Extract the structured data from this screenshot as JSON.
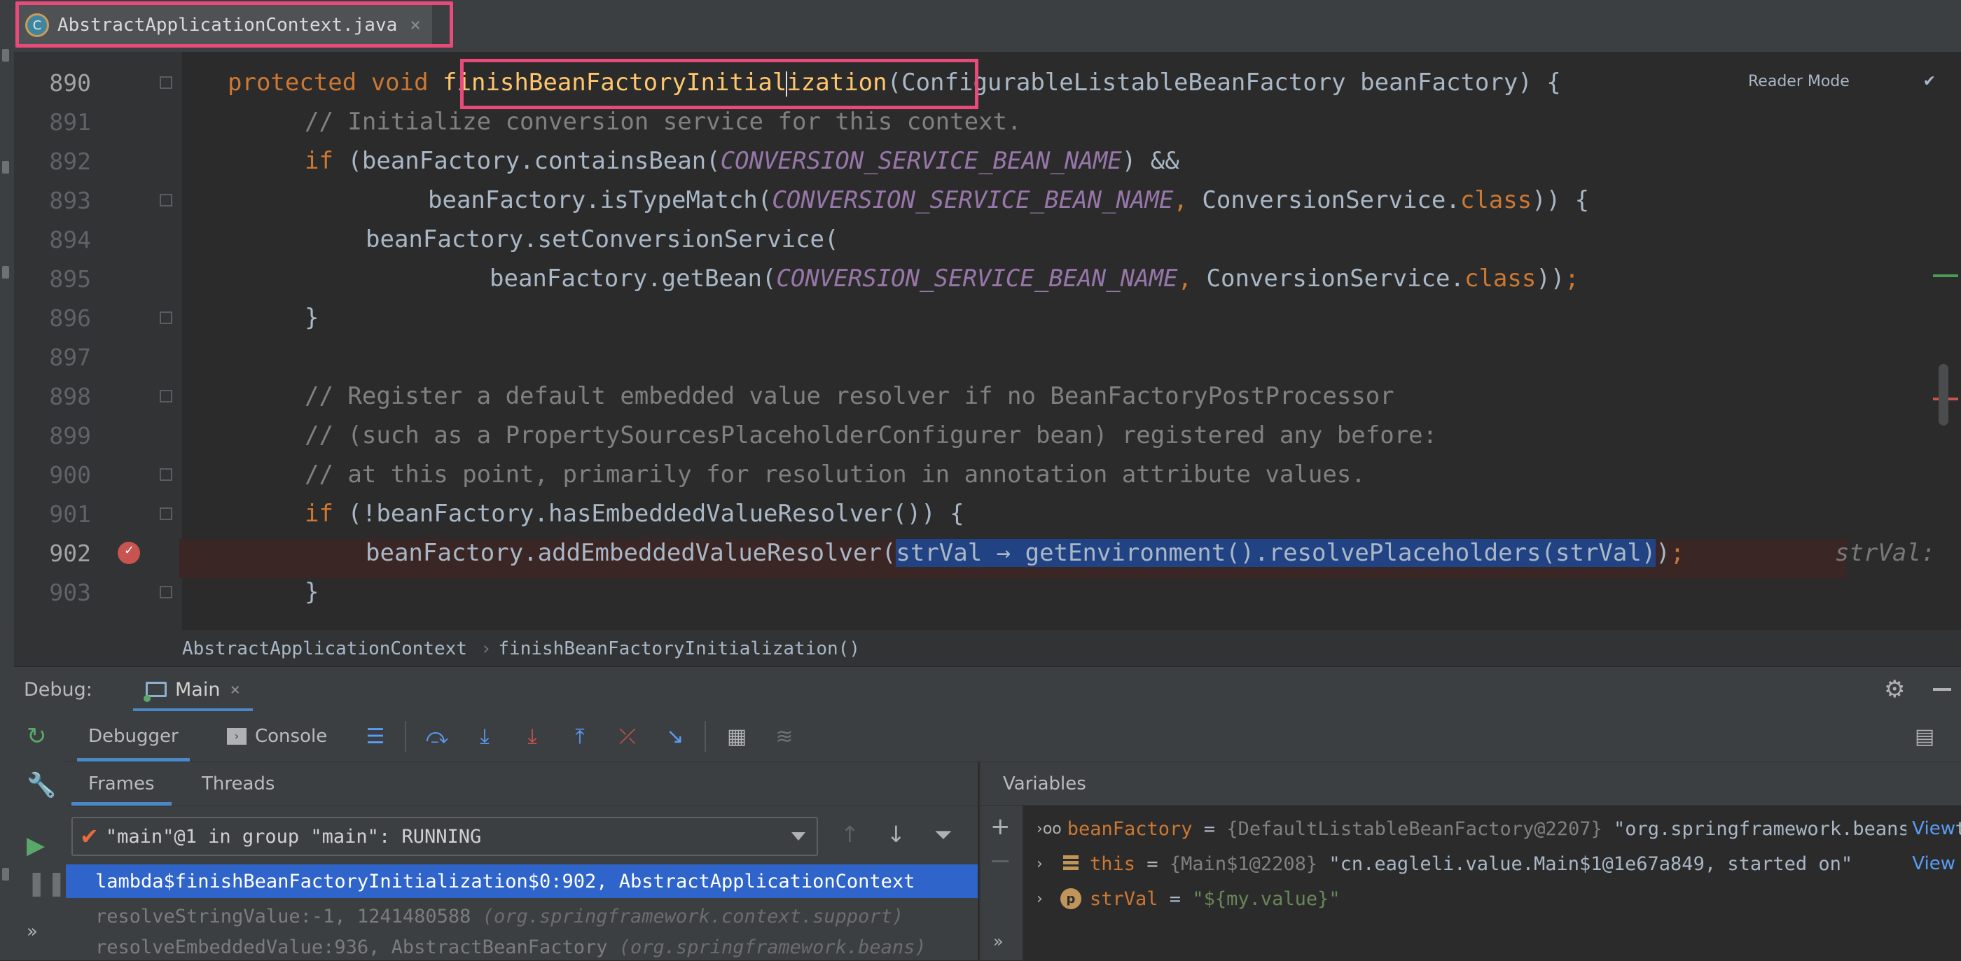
{
  "editor_tab": {
    "icon_letter": "C",
    "title": "AbstractApplicationContext.java",
    "close_glyph": "×"
  },
  "reader_mode": {
    "label": "Reader Mode"
  },
  "code": {
    "lines": [
      {
        "num": "890"
      },
      {
        "num": "891"
      },
      {
        "num": "892"
      },
      {
        "num": "893"
      },
      {
        "num": "894"
      },
      {
        "num": "895"
      },
      {
        "num": "896"
      },
      {
        "num": "897"
      },
      {
        "num": "898"
      },
      {
        "num": "899"
      },
      {
        "num": "900"
      },
      {
        "num": "901"
      },
      {
        "num": "902"
      },
      {
        "num": "903"
      }
    ],
    "l890": {
      "kw": "protected void ",
      "fn_a": "finishBeanFactoryInitial",
      "fn_b": "ization",
      "rest": "(ConfigurableListableBeanFactory beanFactory) {"
    },
    "l891": "// Initialize conversion service for this context.",
    "l892": {
      "kw": "if ",
      "a": "(beanFactory.containsBean(",
      "c": "CONVERSION_SERVICE_BEAN_NAME",
      "b": ") &&"
    },
    "l893": {
      "a": "beanFactory.isTypeMatch(",
      "c": "CONVERSION_SERVICE_BEAN_NAME",
      "comma": ", ",
      "b": "ConversionService.",
      "kw": "class",
      "d": ")) {"
    },
    "l894": "beanFactory.setConversionService(",
    "l895": {
      "a": "beanFactory.getBean(",
      "c": "CONVERSION_SERVICE_BEAN_NAME",
      "comma": ", ",
      "b": "ConversionService.",
      "kw": "class",
      "d": "))",
      "semi": ";"
    },
    "l896": "}",
    "l898": "// Register a default embedded value resolver if no BeanFactoryPostProcessor",
    "l899": "// (such as a PropertySourcesPlaceholderConfigurer bean) registered any before:",
    "l900": "// at this point, primarily for resolution in annotation attribute values.",
    "l901": {
      "kw": "if ",
      "a": "(!beanFactory.hasEmbeddedValueResolver()) {"
    },
    "l902": {
      "a": "beanFactory.addEmbeddedValueResolver(",
      "sel": "strVal → getEnvironment().resolvePlaceholders(strVal)",
      "b": ")",
      "semi": ";",
      "hint": "strVal:"
    },
    "l903": "}"
  },
  "breadcrumbs": {
    "class_name": "AbstractApplicationContext",
    "separator": "›",
    "method": "finishBeanFactoryInitialization()"
  },
  "debug": {
    "label": "Debug:",
    "session_tab": "Main",
    "close_glyph": "×",
    "tabs": {
      "debugger": "Debugger",
      "console": "Console"
    },
    "frames_tab": "Frames",
    "threads_tab": "Threads",
    "thread_select": "\"main\"@1 in group \"main\": RUNNING",
    "frames": [
      {
        "name": "lambda$finishBeanFactoryInitialization$0:902, AbstractApplicationContext",
        "pkg": ""
      },
      {
        "name": "resolveStringValue:-1, 1241480588 ",
        "pkg": "(org.springframework.context.support)"
      },
      {
        "name": "resolveEmbeddedValue:936, AbstractBeanFactory ",
        "pkg": "(org.springframework.beans)"
      }
    ],
    "variables_title": "Variables",
    "variables": [
      {
        "name": "beanFactory",
        "eq": " = ",
        "type": "{DefaultListableBeanFactory@2207} ",
        "value": "\"org.springframework.beans.factory.support.DefaultListableBeanFactory\"",
        "view": "View"
      },
      {
        "name": "this",
        "eq": " = ",
        "type": "{Main$1@2208} ",
        "value": "\"cn.eagleli.value.Main$1@1e67a849, started on\"",
        "view": "View"
      },
      {
        "name": "strVal",
        "eq": " = ",
        "type": "",
        "value": "\"${my.value}\"",
        "view": ""
      }
    ],
    "more_glyph": "»"
  },
  "colors": {
    "accent_highlight": "#e84a7a",
    "selection": "#2f65ca",
    "keyword": "#cc7832",
    "method": "#ffc66d",
    "constant": "#9876aa",
    "comment": "#808080",
    "string": "#6a8759",
    "breakpoint": "#c75450"
  }
}
